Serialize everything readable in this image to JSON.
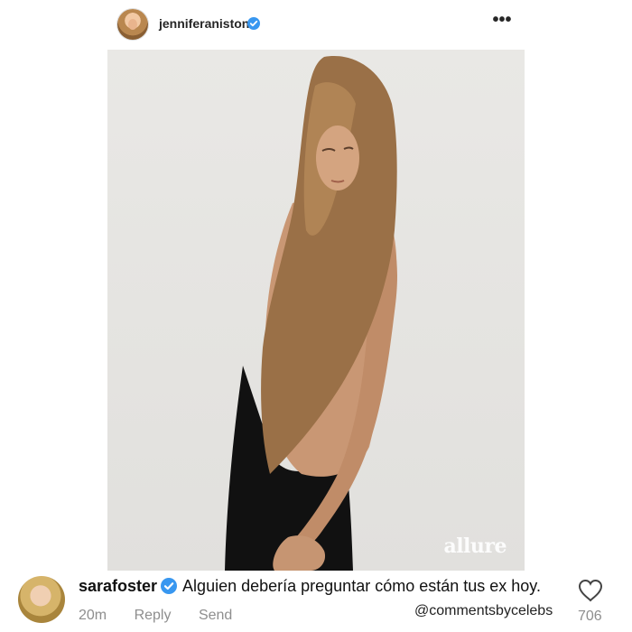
{
  "post": {
    "username": "jenniferaniston",
    "verified_icon": "verified-badge-icon",
    "more_icon": "more-options-icon",
    "more_glyph": "•••",
    "photo": {
      "description_icon": "photo",
      "watermark": "allure"
    }
  },
  "comment": {
    "username": "sarafoster",
    "text": "Alguien debería preguntar cómo están tus ex hoy.",
    "time": "20m",
    "reply_label": "Reply",
    "send_label": "Send",
    "likes": "706",
    "heart_icon": "heart-outline-icon"
  },
  "credit": "@commentsbycelebs",
  "colors": {
    "verified": "#3897f0",
    "meta_gray": "#8e8e8e",
    "background": "#ffffff"
  }
}
